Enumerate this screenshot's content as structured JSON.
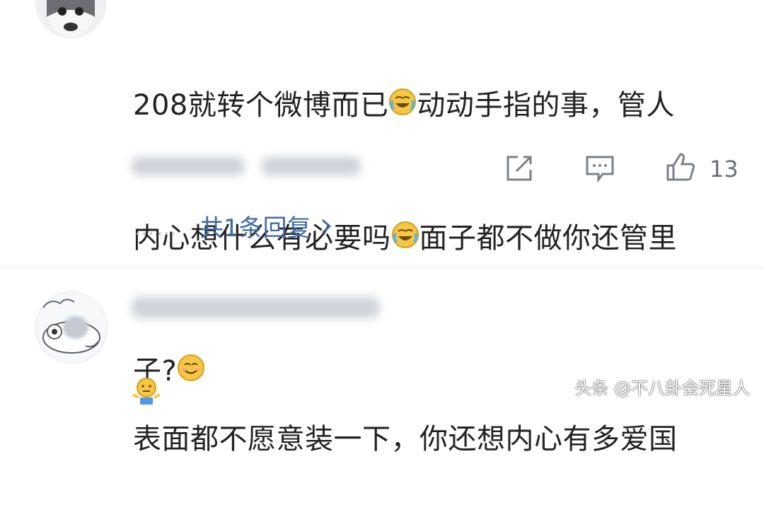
{
  "comments": [
    {
      "text_lines": [
        [
          "208就转个微博而已",
          {
            "emoji": "laugh-cry"
          },
          "动动手指的事，管人"
        ],
        [
          "内心想什么有必要吗",
          {
            "emoji": "laugh-cry"
          },
          "面子都不做你还管里"
        ],
        [
          "子?",
          {
            "emoji": "smile"
          }
        ]
      ],
      "likes": "13",
      "reply_link": "共1条回复",
      "dots": "……"
    },
    {
      "text_lines": [
        [
          "表面都不愿意装一下，你还想内心有多爱国"
        ]
      ],
      "trailing_emoji": "shrug"
    }
  ],
  "watermark": "头条 @不八卦会死星人"
}
